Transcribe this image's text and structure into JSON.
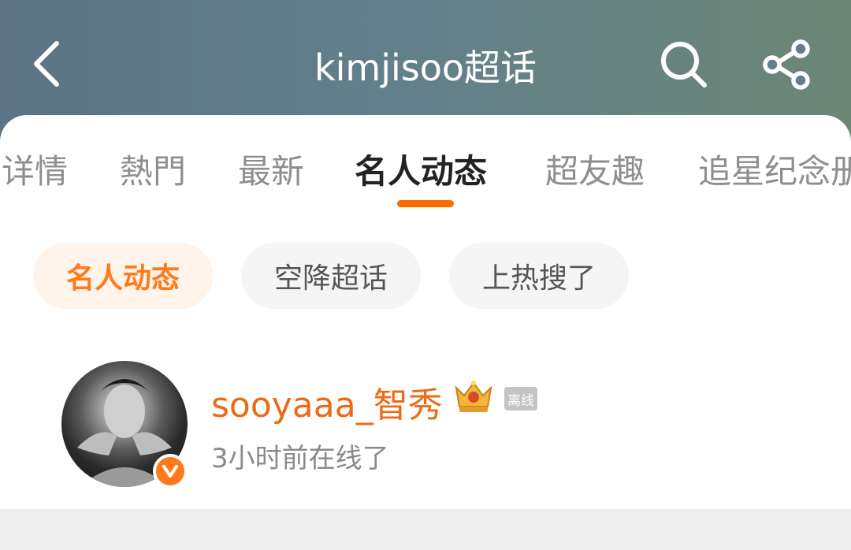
{
  "header": {
    "title": "kimjisoo超话",
    "back_icon": "chevron-left-icon",
    "search_icon": "search-icon",
    "share_icon": "share-icon"
  },
  "tabs": [
    {
      "label": "详情"
    },
    {
      "label": "熱門"
    },
    {
      "label": "最新"
    },
    {
      "label": "名人动态",
      "active": true
    },
    {
      "label": "超友趣"
    },
    {
      "label": "追星纪念册"
    }
  ],
  "filters": [
    {
      "label": "名人动态",
      "active": true
    },
    {
      "label": "空降超话"
    },
    {
      "label": "上热搜了"
    }
  ],
  "user": {
    "name": "sooyaaa_智秀",
    "status_badge": "离线",
    "last_online": "3小时前在线了",
    "verified_badge": "v",
    "crown_icon": "crown-icon"
  },
  "colors": {
    "accent": "#ff6a00",
    "username": "#ec6a14",
    "header_gradient_start": "#5c7485",
    "header_gradient_end": "#6c8776"
  }
}
